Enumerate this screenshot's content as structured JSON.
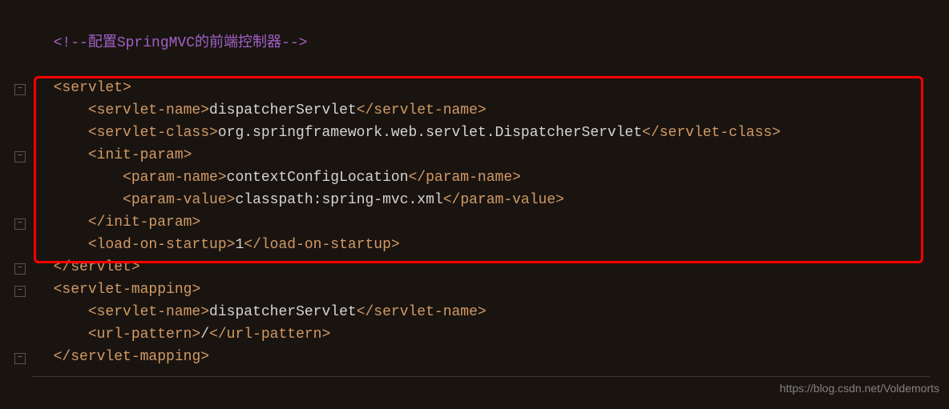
{
  "code": {
    "comment": "<!--配置SpringMVC的前端控制器-->",
    "servlet_open": "<servlet>",
    "servlet_name_open": "<servlet-name>",
    "servlet_name_val": "dispatcherServlet",
    "servlet_name_close": "</servlet-name>",
    "servlet_class_open": "<servlet-class>",
    "servlet_class_val": "org.springframework.web.servlet.DispatcherServlet",
    "servlet_class_close": "</servlet-class>",
    "init_param_open": "<init-param>",
    "param_name_open": "<param-name>",
    "param_name_val": "contextConfigLocation",
    "param_name_close": "</param-name>",
    "param_value_open": "<param-value>",
    "param_value_val": "classpath:spring-mvc.xml",
    "param_value_close": "</param-value>",
    "init_param_close": "</init-param>",
    "load_startup_open": "<load-on-startup>",
    "load_startup_val": "1",
    "load_startup_close": "</load-on-startup>",
    "servlet_close": "</servlet>",
    "servlet_mapping_open": "<servlet-mapping>",
    "url_pattern_open": "<url-pattern>",
    "url_pattern_val": "/",
    "url_pattern_close": "</url-pattern>",
    "servlet_mapping_close": "</servlet-mapping>"
  },
  "watermark": "https://blog.csdn.net/Voldemorts"
}
